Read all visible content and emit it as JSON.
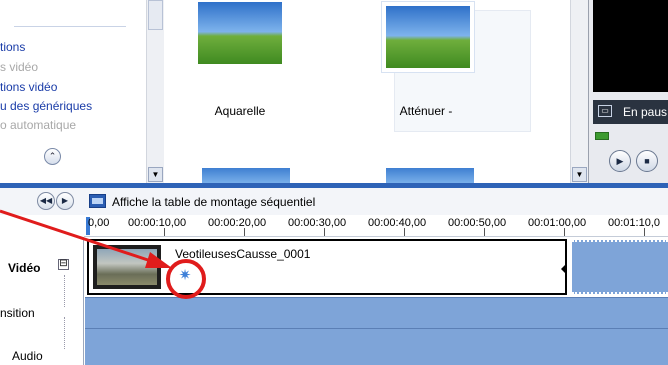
{
  "task_pane": {
    "items": [
      {
        "label": "tions",
        "style": "link"
      },
      {
        "label": "s vidéo",
        "style": "disabled"
      },
      {
        "label": "tions vidéo",
        "style": "link"
      },
      {
        "label": "u des génériques",
        "style": "link"
      },
      {
        "label": "o automatique",
        "style": "disabled"
      }
    ],
    "collapse_icon": "chevron-up-icon"
  },
  "effects": {
    "items": [
      {
        "label": "Aquarelle"
      },
      {
        "label": "Atténuer -"
      }
    ]
  },
  "monitor": {
    "status_text": "En paus",
    "status_icon": "screen-icon",
    "controls": [
      "play-icon",
      "stop-icon"
    ]
  },
  "toolbar": {
    "storyboard_label": "Affiche la table de montage séquentiel",
    "buttons": [
      "rewind-icon",
      "play-icon"
    ]
  },
  "timeline": {
    "ruler_ticks": [
      "0,00",
      "00:00:10,00",
      "00:00:20,00",
      "00:00:30,00",
      "00:00:40,00",
      "00:00:50,00",
      "00:01:00,00",
      "00:01:10,0"
    ]
  },
  "tracks": {
    "video_label": "Vidéo",
    "video_toggle": "⊟",
    "transition_label": "nsition",
    "audio_label": "Audio"
  },
  "clip": {
    "name": "VeotileusesCausse_0001",
    "effect_icon": "star-effect-icon"
  },
  "annotation": {
    "color": "#e01c1c"
  }
}
